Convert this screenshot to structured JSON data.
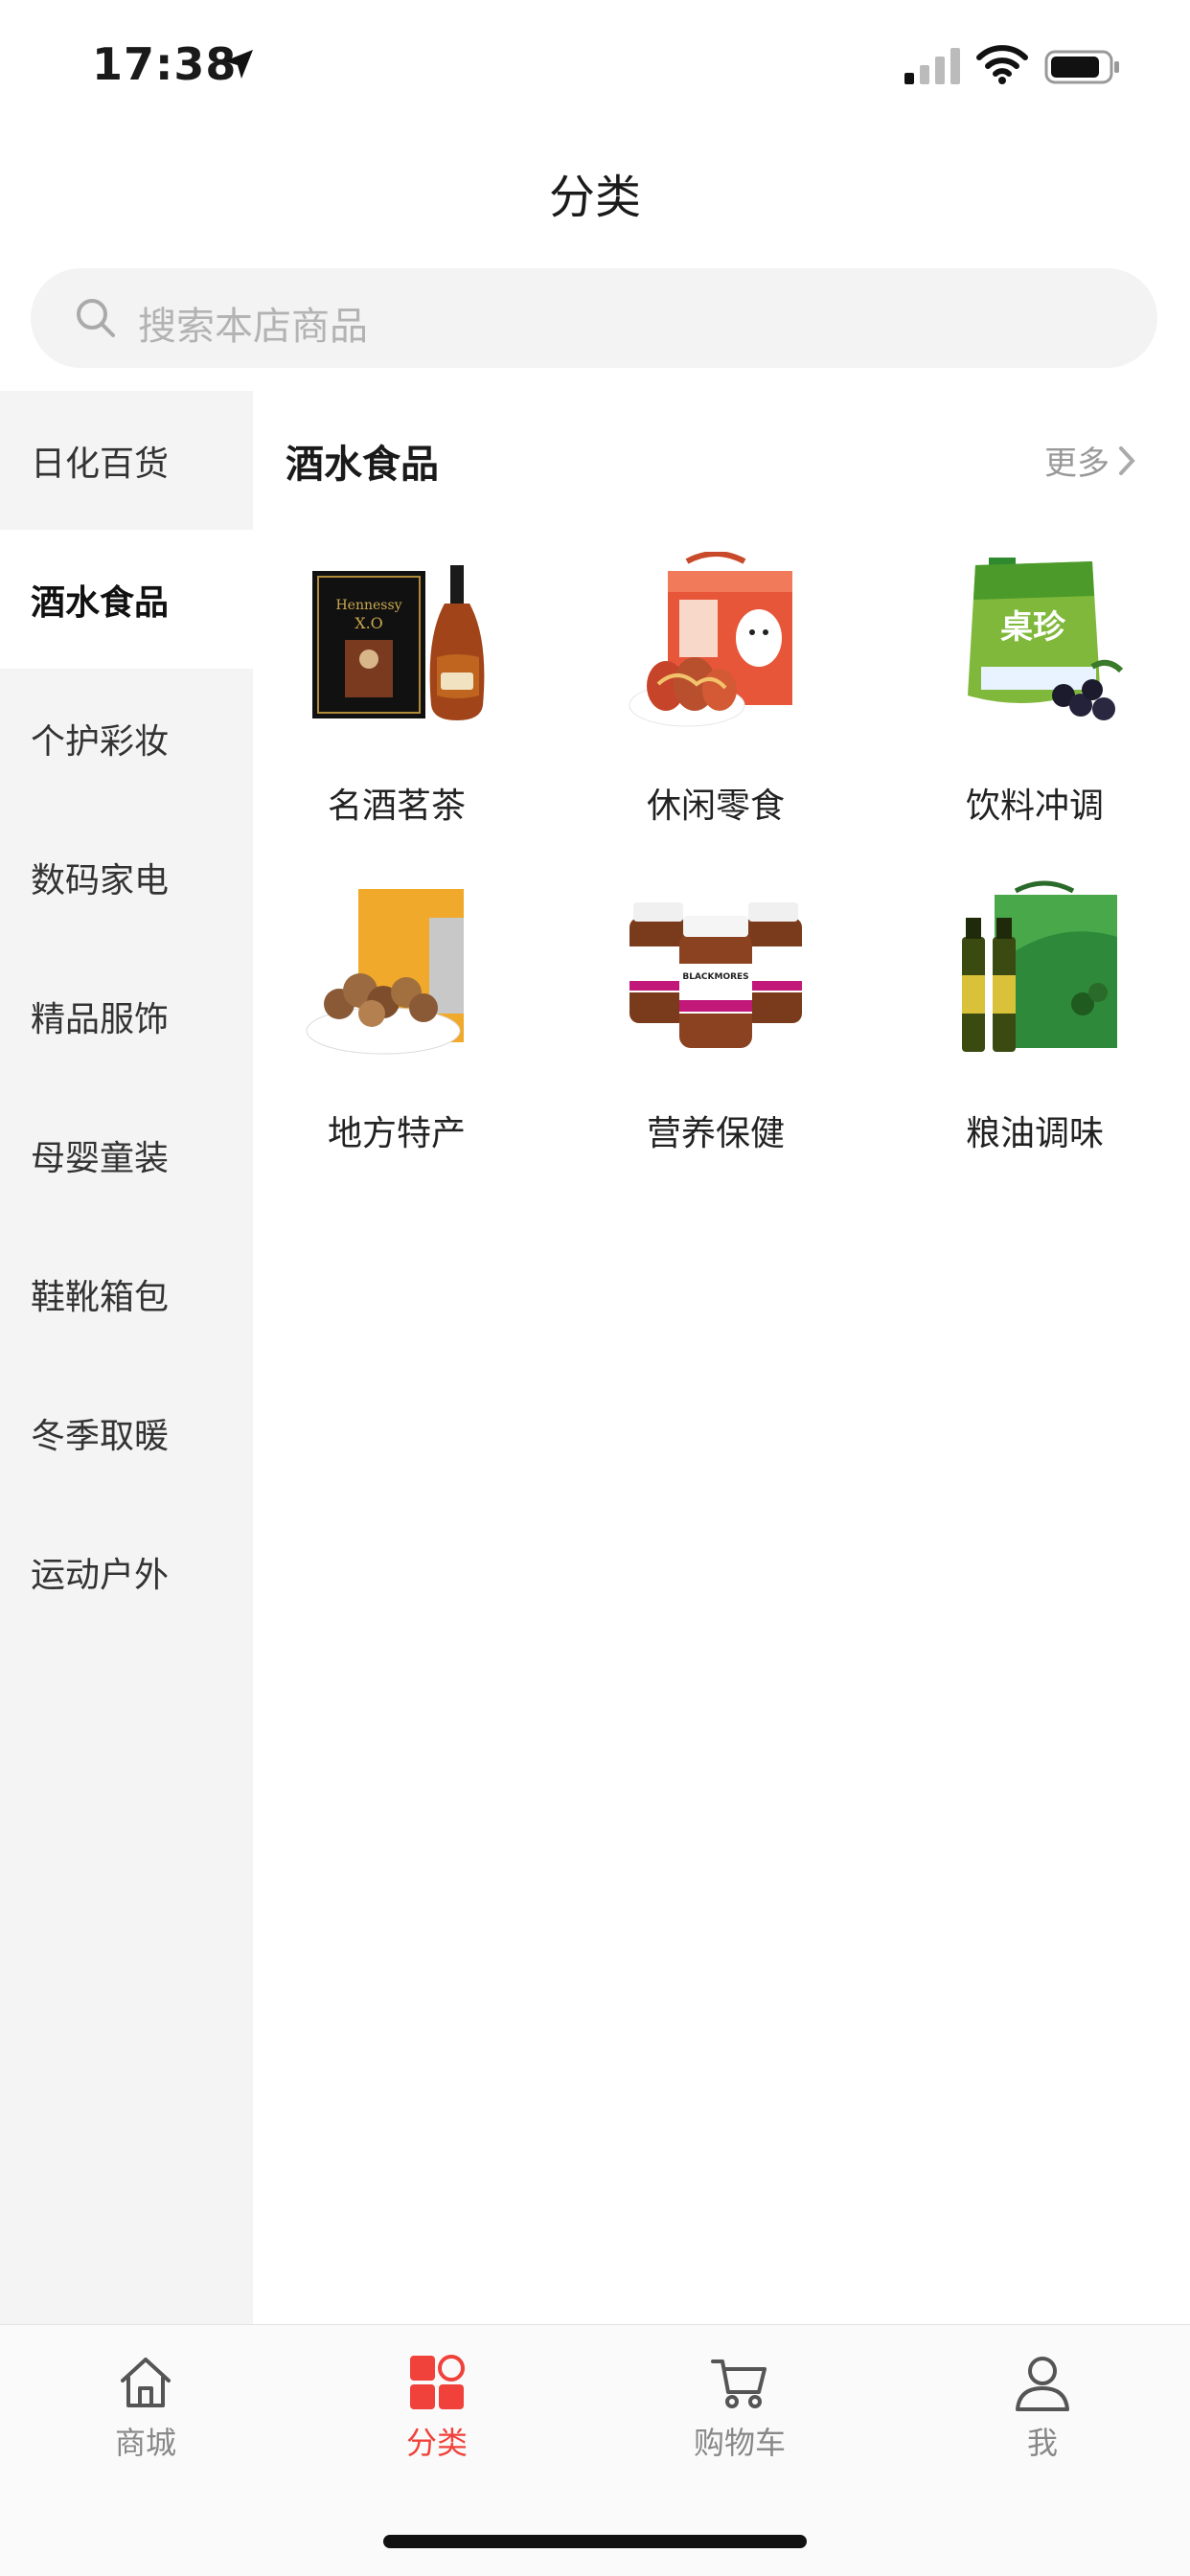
{
  "status_bar": {
    "time": "17:38"
  },
  "header": {
    "title": "分类"
  },
  "search": {
    "placeholder": "搜索本店商品"
  },
  "sidebar": {
    "items": [
      {
        "label": "日化百货",
        "active": false
      },
      {
        "label": "酒水食品",
        "active": true
      },
      {
        "label": "个护彩妆",
        "active": false
      },
      {
        "label": "数码家电",
        "active": false
      },
      {
        "label": "精品服饰",
        "active": false
      },
      {
        "label": "母婴童装",
        "active": false
      },
      {
        "label": "鞋靴箱包",
        "active": false
      },
      {
        "label": "冬季取暖",
        "active": false
      },
      {
        "label": "运动户外",
        "active": false
      }
    ]
  },
  "content": {
    "section_title": "酒水食品",
    "more_label": "更多",
    "categories": [
      {
        "label": "名酒茗茶",
        "icon": "cognac-bottle-image"
      },
      {
        "label": "休闲零食",
        "icon": "snack-box-image"
      },
      {
        "label": "饮料冲调",
        "icon": "drink-pouch-image"
      },
      {
        "label": "地方特产",
        "icon": "mushroom-bowl-image"
      },
      {
        "label": "营养保健",
        "icon": "supplement-bottles-image"
      },
      {
        "label": "粮油调味",
        "icon": "olive-oil-box-image"
      }
    ]
  },
  "tab_bar": {
    "tabs": [
      {
        "label": "商城",
        "icon": "home-icon",
        "active": false
      },
      {
        "label": "分类",
        "icon": "category-grid-icon",
        "active": true
      },
      {
        "label": "购物车",
        "icon": "cart-icon",
        "active": false
      },
      {
        "label": "我",
        "icon": "user-icon",
        "active": false
      }
    ]
  },
  "colors": {
    "accent": "#f0423a",
    "sidebar_bg": "#f4f4f4",
    "search_bg": "#f3f3f3"
  }
}
